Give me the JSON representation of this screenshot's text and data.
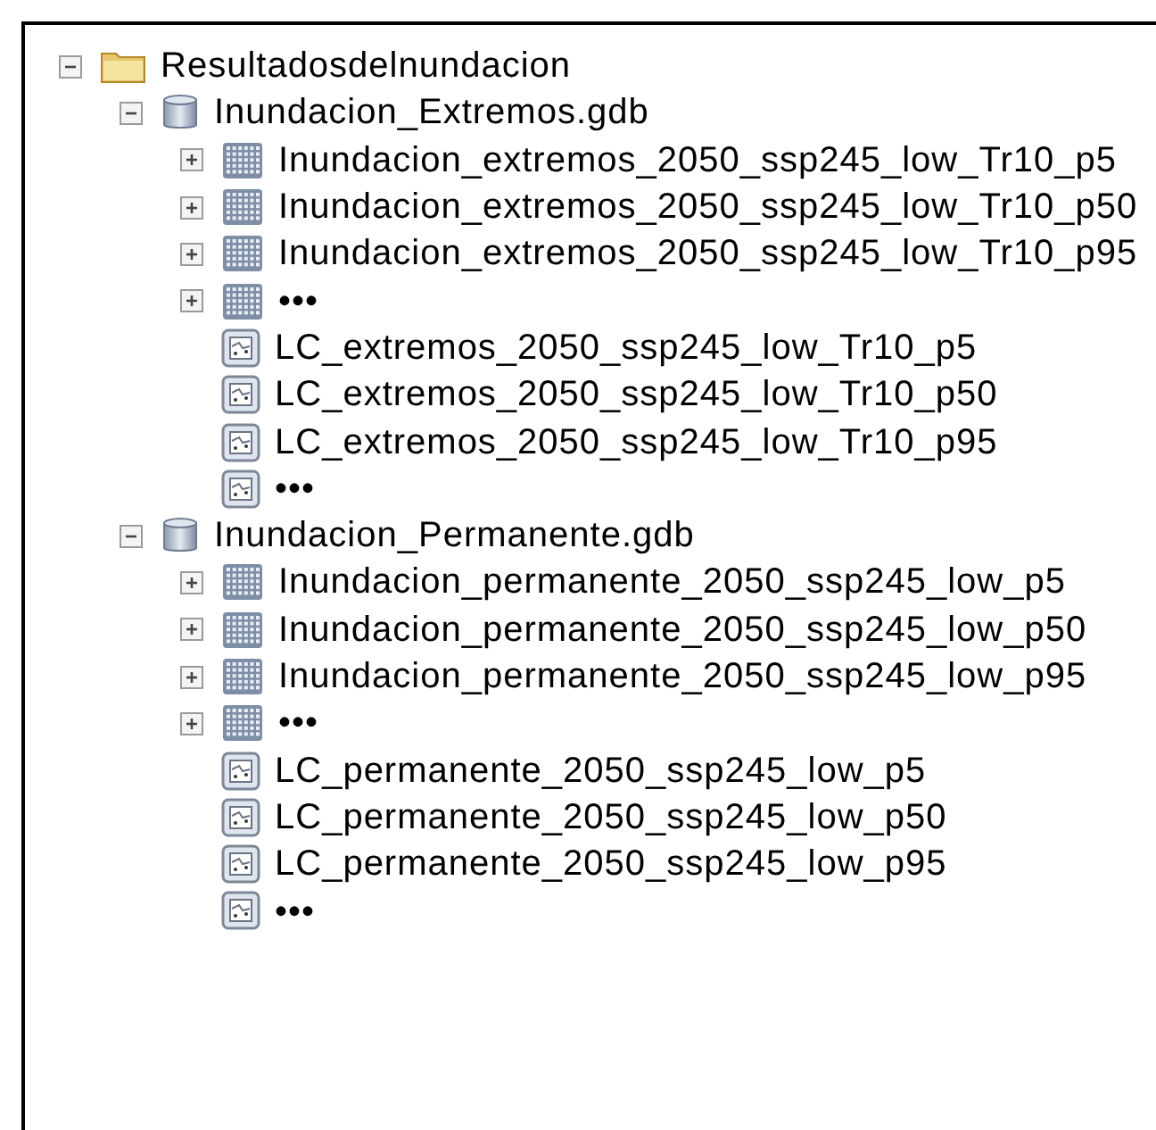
{
  "tree": [
    {
      "kind": "folder",
      "label": "Resultadosdelnundacion",
      "expanded": true,
      "children": [
        {
          "kind": "database",
          "label": "Inundacion_Extremos.gdb",
          "expanded": true,
          "children": [
            {
              "kind": "raster",
              "label": "Inundacion_extremos_2050_ssp245_low_Tr10_p5",
              "expanded": false
            },
            {
              "kind": "raster",
              "label": "Inundacion_extremos_2050_ssp245_low_Tr10_p50",
              "expanded": false
            },
            {
              "kind": "raster",
              "label": "Inundacion_extremos_2050_ssp245_low_Tr10_p95",
              "expanded": false
            },
            {
              "kind": "raster",
              "label": "•••",
              "expanded": false
            },
            {
              "kind": "table",
              "label": "LC_extremos_2050_ssp245_low_Tr10_p5"
            },
            {
              "kind": "table",
              "label": "LC_extremos_2050_ssp245_low_Tr10_p50"
            },
            {
              "kind": "table",
              "label": "LC_extremos_2050_ssp245_low_Tr10_p95"
            },
            {
              "kind": "table",
              "label": "•••"
            }
          ]
        },
        {
          "kind": "database",
          "label": "Inundacion_Permanente.gdb",
          "expanded": true,
          "children": [
            {
              "kind": "raster",
              "label": "Inundacion_permanente_2050_ssp245_low_p5",
              "expanded": false
            },
            {
              "kind": "raster",
              "label": "Inundacion_permanente_2050_ssp245_low_p50",
              "expanded": false
            },
            {
              "kind": "raster",
              "label": "Inundacion_permanente_2050_ssp245_low_p95",
              "expanded": false
            },
            {
              "kind": "raster",
              "label": "•••",
              "expanded": false
            },
            {
              "kind": "table",
              "label": "LC_permanente_2050_ssp245_low_p5"
            },
            {
              "kind": "table",
              "label": "LC_permanente_2050_ssp245_low_p50"
            },
            {
              "kind": "table",
              "label": "LC_permanente_2050_ssp245_low_p95"
            },
            {
              "kind": "table",
              "label": "•••"
            }
          ]
        }
      ]
    }
  ]
}
